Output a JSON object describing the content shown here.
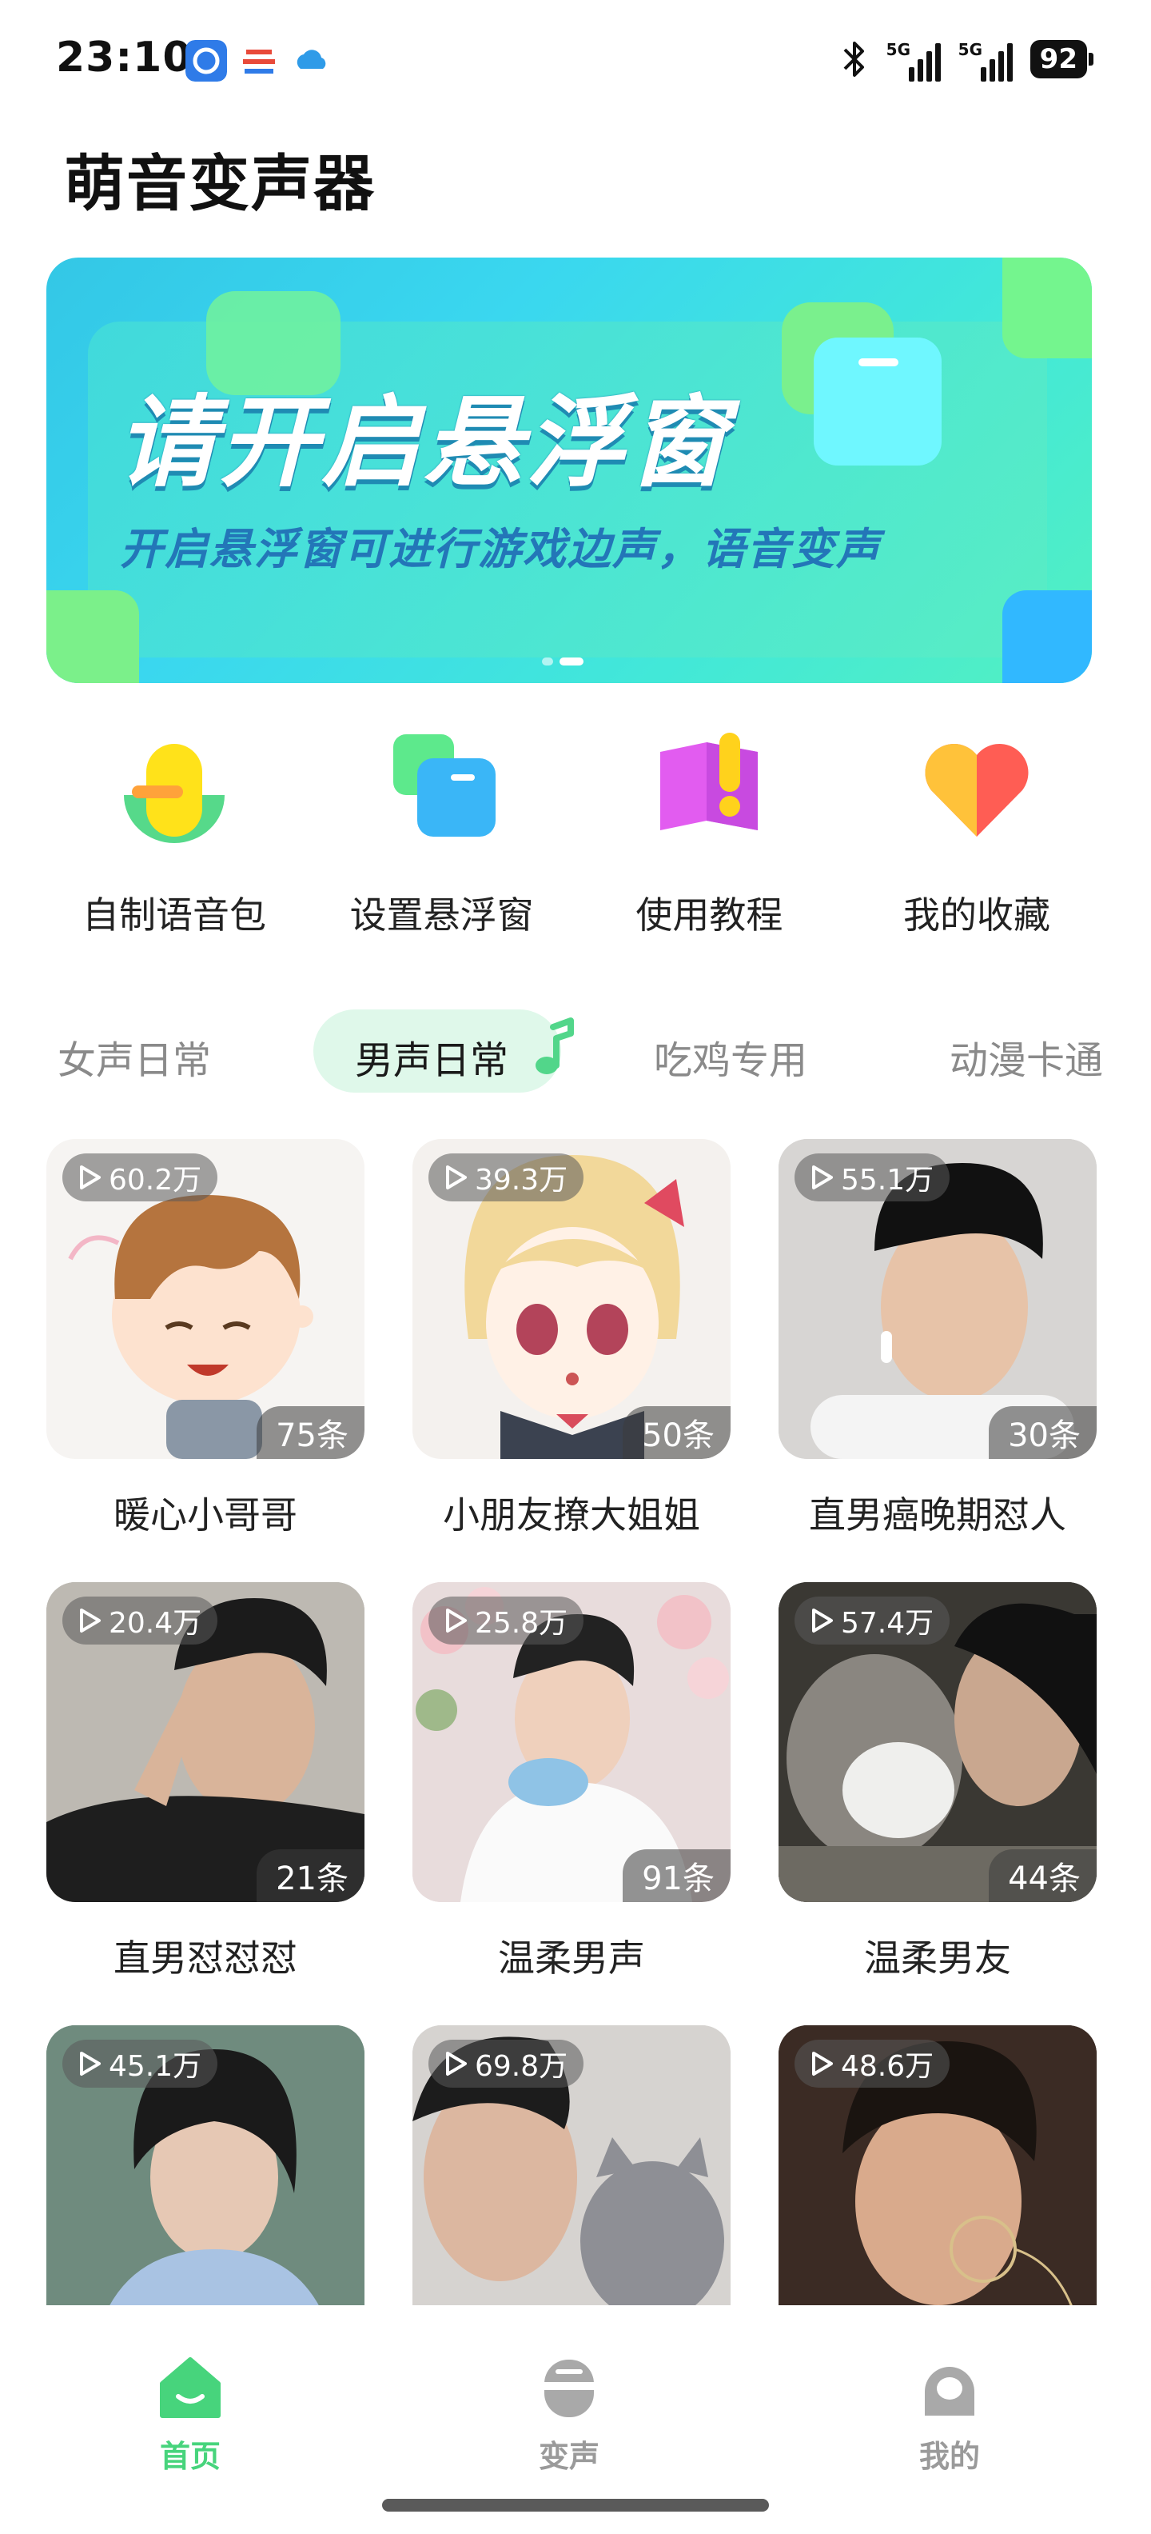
{
  "status_bar": {
    "time": "23:10",
    "signal_label_1": "5G",
    "signal_label_2": "5G",
    "battery": "92",
    "app_icons": [
      "app-icon-blue",
      "app-icon-red",
      "app-icon-cloud"
    ]
  },
  "app_title": "萌音变声器",
  "banner": {
    "heading": "请开启悬浮窗",
    "subtitle": "开启悬浮窗可进行游戏边声，语音变声",
    "page_count": 2,
    "active_page": 2
  },
  "quick_actions": [
    {
      "label": "自制语音包",
      "icon": "microphone-icon"
    },
    {
      "label": "设置悬浮窗",
      "icon": "floating-window-icon"
    },
    {
      "label": "使用教程",
      "icon": "book-icon"
    },
    {
      "label": "我的收藏",
      "icon": "heart-icon"
    }
  ],
  "tabs": [
    {
      "label": "女声日常",
      "active": false
    },
    {
      "label": "男声日常",
      "active": true
    },
    {
      "label": "吃鸡专用",
      "active": false
    },
    {
      "label": "动漫卡通",
      "active": false
    }
  ],
  "cards": [
    {
      "title": "暖心小哥哥",
      "plays": "60.2万",
      "count": "75条"
    },
    {
      "title": "小朋友撩大姐姐",
      "plays": "39.3万",
      "count": "50条"
    },
    {
      "title": "直男癌晚期怼人",
      "plays": "55.1万",
      "count": "30条"
    },
    {
      "title": "直男怼怼怼",
      "plays": "20.4万",
      "count": "21条"
    },
    {
      "title": "温柔男声",
      "plays": "25.8万",
      "count": "91条"
    },
    {
      "title": "温柔男友",
      "plays": "57.4万",
      "count": "44条"
    },
    {
      "title": "",
      "plays": "45.1万",
      "count": ""
    },
    {
      "title": "",
      "plays": "69.8万",
      "count": ""
    },
    {
      "title": "",
      "plays": "48.6万",
      "count": ""
    }
  ],
  "bottom_nav": [
    {
      "label": "首页",
      "active": true,
      "icon": "home-icon"
    },
    {
      "label": "变声",
      "active": false,
      "icon": "voice-change-icon"
    },
    {
      "label": "我的",
      "active": false,
      "icon": "profile-icon"
    }
  ],
  "colors": {
    "accent_green": "#47d47c",
    "tab_pill": "#dff8ea",
    "banner_blue": "#33c7e6",
    "inactive_gray": "#9a9a9a"
  }
}
